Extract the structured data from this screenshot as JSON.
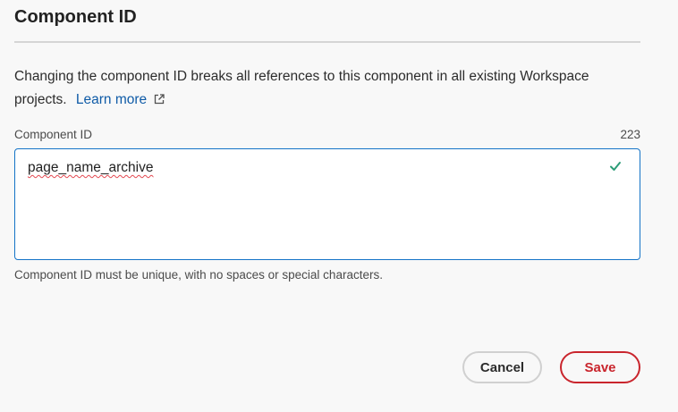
{
  "dialog": {
    "title": "Component ID",
    "description": "Changing the component ID breaks all references to this component in all existing Workspace projects.",
    "learn_more_label": "Learn more",
    "field": {
      "label": "Component ID",
      "char_count": "223",
      "value": "page_name_archive",
      "help_text": "Component ID must be unique, with no spaces or special characters.",
      "valid_icon": "checkmark-icon"
    },
    "buttons": {
      "cancel_label": "Cancel",
      "save_label": "Save"
    }
  },
  "colors": {
    "background": "#f8f8f8",
    "link": "#0f5ba7",
    "focus_border": "#1473c7",
    "valid": "#2d9d78",
    "destructive": "#c9252d"
  }
}
